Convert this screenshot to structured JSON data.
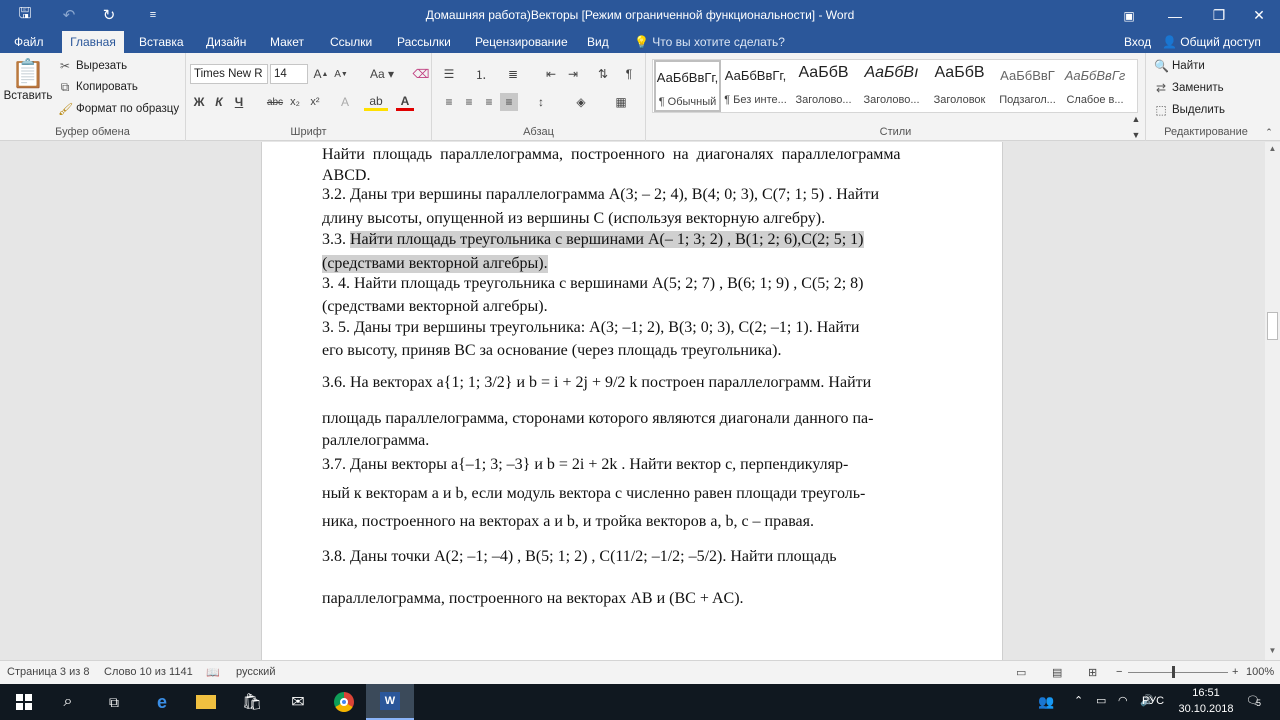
{
  "title": "Домашняя работа)Векторы [Режим ограниченной функциональности] - Word",
  "tabs": [
    "Файл",
    "Главная",
    "Вставка",
    "Дизайн",
    "Макет",
    "Ссылки",
    "Рассылки",
    "Рецензирование",
    "Вид"
  ],
  "tellme": "Что вы хотите сделать?",
  "signin": "Вход",
  "share": "Общий доступ",
  "clipboard": {
    "paste": "Вставить",
    "cut": "Вырезать",
    "copy": "Копировать",
    "format": "Формат по образцу",
    "label": "Буфер обмена"
  },
  "font": {
    "name": "Times New R",
    "size": "14",
    "label": "Шрифт"
  },
  "paragraph": {
    "label": "Абзац"
  },
  "styles": {
    "label": "Стили",
    "items": [
      {
        "preview": "АаБбВвГг,",
        "name": "¶ Обычный"
      },
      {
        "preview": "АаБбВвГг,",
        "name": "¶ Без инте..."
      },
      {
        "preview": "АаБбВ",
        "name": "Заголово..."
      },
      {
        "preview": "АаБбВı",
        "name": "Заголово..."
      },
      {
        "preview": "АаБбВ",
        "name": "Заголовок"
      },
      {
        "preview": "АаБбВвГ",
        "name": "Подзагол..."
      },
      {
        "preview": "АаБбВвГг",
        "name": "Слабое в..."
      }
    ]
  },
  "editing": {
    "find": "Найти",
    "replace": "Заменить",
    "select": "Выделить",
    "label": "Редактирование"
  },
  "doc": {
    "l1": "Найти площадь параллелограмма, построенного на диагоналях параллелограмма",
    "l2": "ABCD.",
    "l3": "3.2. Даны три вершины параллелограмма A(3; – 2; 4), B(4; 0; 3), C(7; 1; 5) . Найти",
    "l4": "длину высоты, опущенной из вершины С (используя векторную алгебру).",
    "l5a": "3.3. ",
    "l5b": "Найти площадь треугольника с вершинами A(– 1; 3; 2) , B(1; 2; 6),C(2; 5; 1)",
    "l6": "(средствами векторной алгебры).",
    "l7": "3. 4. Найти площадь треугольника с вершинами A(5; 2; 7) , B(6; 1; 9) , C(5; 2; 8)",
    "l8": "(средствами векторной алгебры).",
    "l9": "3. 5. Даны три вершины треугольника: A(3; –1; 2), B(3; 0; 3), C(2; –1; 1). Найти",
    "l10": "его высоту, приняв BC за основание (через площадь треугольника).",
    "l11": "3.6. На векторах a{1; 1; 3/2} и b = i + 2j + 9/2 k построен параллелограмм. Найти",
    "l12": "площадь параллелограмма, сторонами которого являются диагонали данного па-",
    "l13": "раллелограмма.",
    "l14": "3.7. Даны векторы a{–1; 3; –3} и b = 2i + 2k . Найти вектор c, перпендикуляр-",
    "l15": "ный к векторам a и b, если модуль вектора c численно равен площади треуголь-",
    "l16": "ника, построенного на векторах a и b, и тройка векторов a, b, c – правая.",
    "l17": "3.8. Даны точки A(2; –1; –4) , B(5; 1; 2) , C(11/2; –1/2; –5/2). Найти площадь",
    "l18": "параллелограмма, построенного на векторах AB и (BC + AC)."
  },
  "status": {
    "page": "Страница 3 из 8",
    "words": "Слово 10 из 1141",
    "lang": "русский",
    "zoom": "100%"
  },
  "taskbar": {
    "time": "16:51",
    "date": "30.10.2018",
    "lang": "РУС",
    "notif": "5"
  }
}
